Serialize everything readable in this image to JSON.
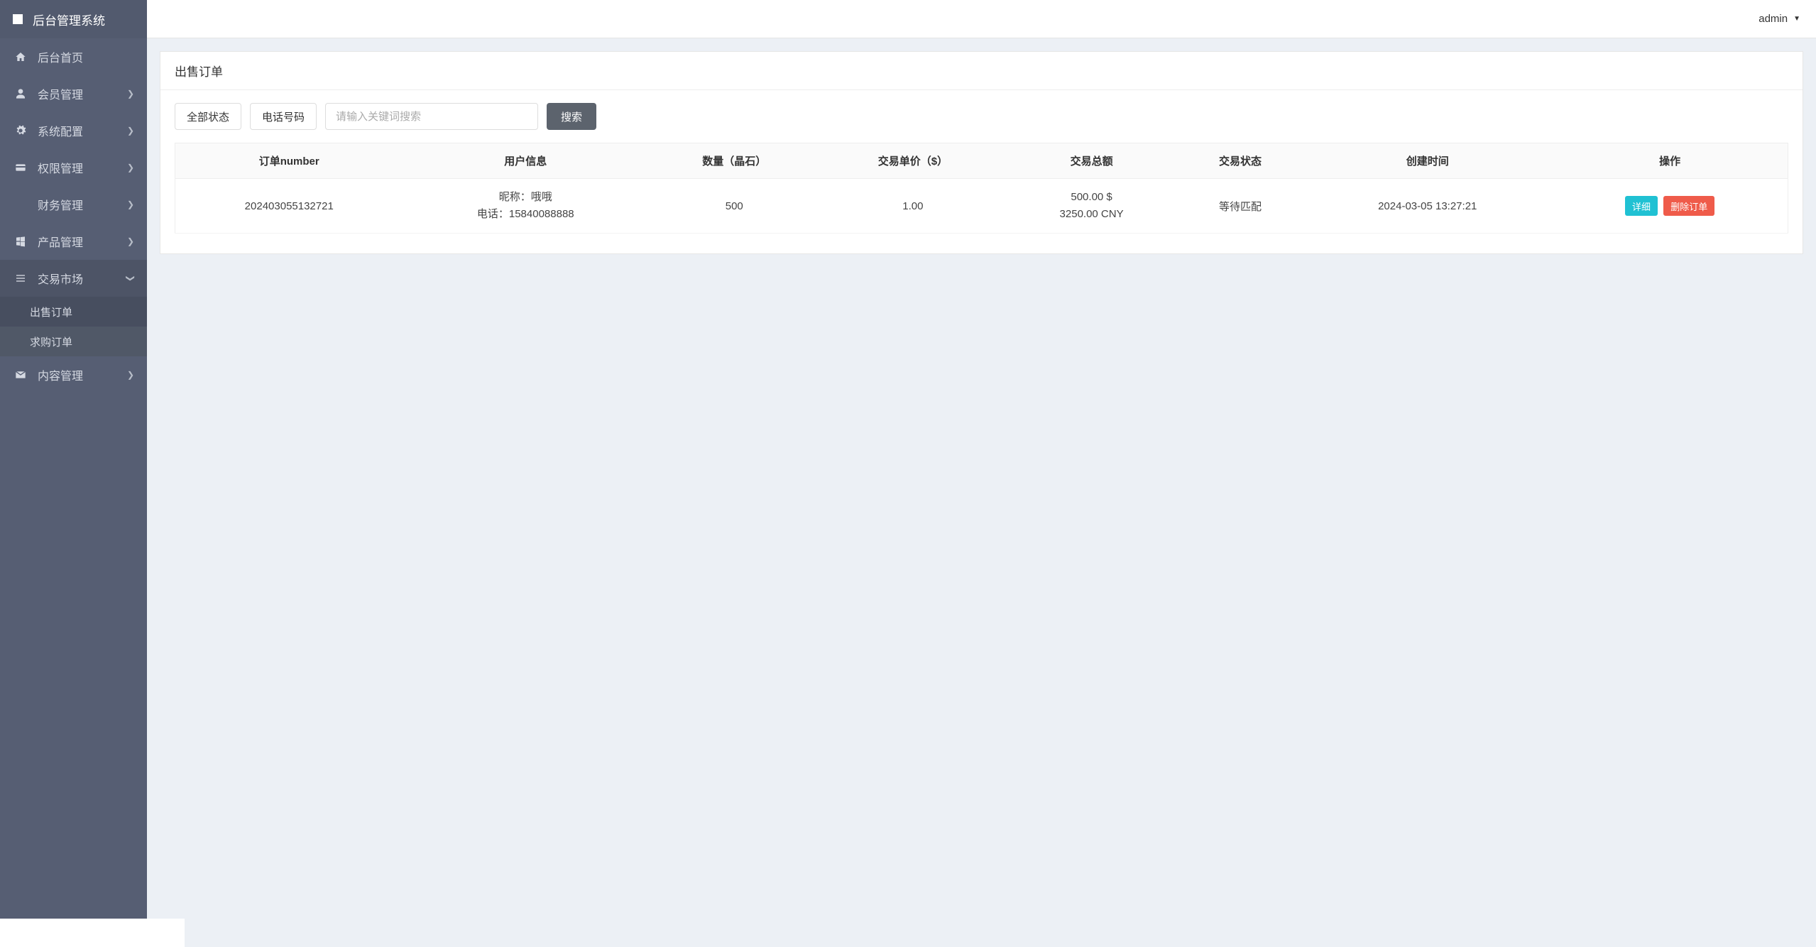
{
  "brand": {
    "title": "后台管理系统"
  },
  "sidebar": {
    "items": [
      {
        "icon": "home",
        "label": "后台首页",
        "has_children": false
      },
      {
        "icon": "user",
        "label": "会员管理",
        "has_children": true
      },
      {
        "icon": "cogs",
        "label": "系统配置",
        "has_children": true
      },
      {
        "icon": "card",
        "label": "权限管理",
        "has_children": true
      },
      {
        "icon": "none",
        "label": "财务管理",
        "has_children": true
      },
      {
        "icon": "windows",
        "label": "产品管理",
        "has_children": true
      },
      {
        "icon": "bars",
        "label": "交易市场",
        "has_children": true,
        "expanded": true,
        "children": [
          {
            "label": "出售订单",
            "active": true
          },
          {
            "label": "求购订单",
            "active": false
          }
        ]
      },
      {
        "icon": "envelope",
        "label": "内容管理",
        "has_children": true
      }
    ]
  },
  "topbar": {
    "user": "admin"
  },
  "page": {
    "title": "出售订单"
  },
  "filters": {
    "status_label": "全部状态",
    "field_label": "电话号码",
    "search_placeholder": "请输入关键词搜索",
    "search_button": "搜索"
  },
  "table": {
    "columns": [
      "订单number",
      "用户信息",
      "数量（晶石）",
      "交易单价（$）",
      "交易总额",
      "交易状态",
      "创建时间",
      "操作"
    ],
    "rows": [
      {
        "order_no": "202403055132721",
        "user_nick_label": "昵称：",
        "user_nick": "哦哦",
        "user_phone_label": "电话：",
        "user_phone": "15840088888",
        "qty": "500",
        "unit_price": "1.00",
        "total_usd": "500.00 $",
        "total_cny": "3250.00 CNY",
        "status": "等待匹配",
        "created": "2024-03-05 13:27:21"
      }
    ],
    "actions": {
      "detail": "详细",
      "delete": "删除订单"
    }
  }
}
